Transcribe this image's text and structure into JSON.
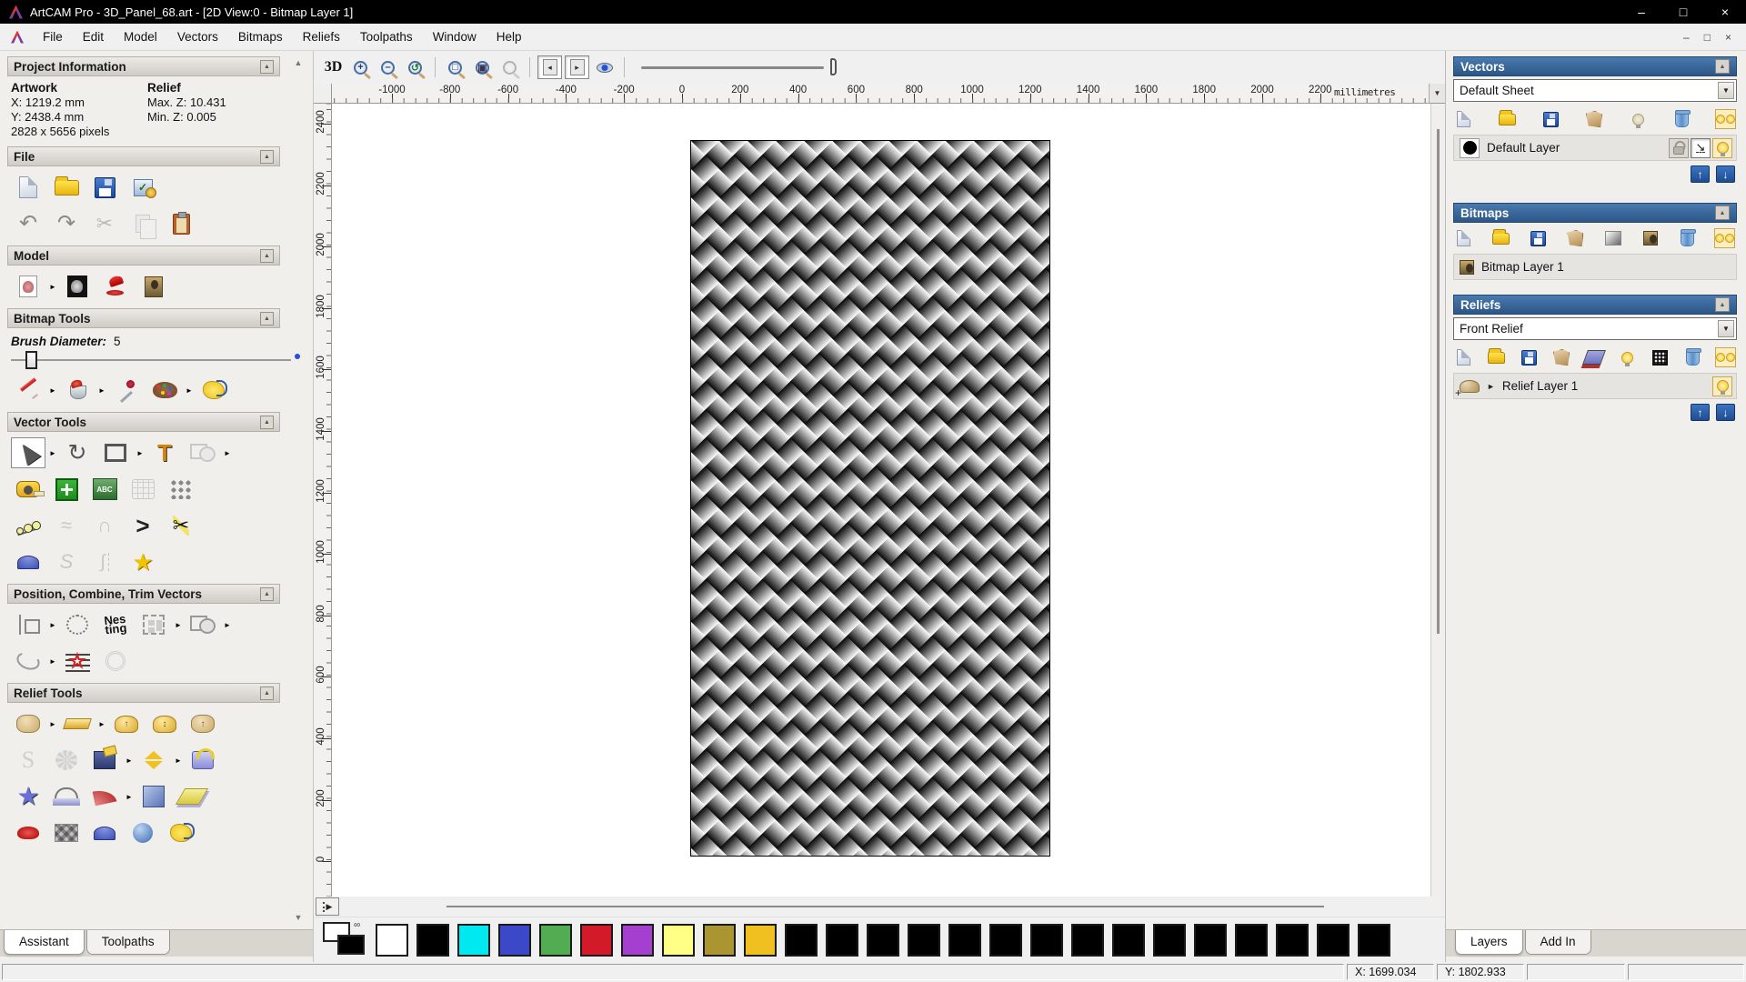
{
  "window": {
    "title": "ArtCAM Pro - 3D_Panel_68.art - [2D View:0 - Bitmap Layer 1]"
  },
  "titlebar": {
    "minimize": "–",
    "maximize": "□",
    "close": "×"
  },
  "menu": {
    "items": [
      "File",
      "Edit",
      "Model",
      "Vectors",
      "Bitmaps",
      "Reliefs",
      "Toolpaths",
      "Window",
      "Help"
    ]
  },
  "mdi": {
    "minimize": "–",
    "restore": "□",
    "close": "×"
  },
  "icons": {
    "collapse": "▲",
    "dropdown": "▼",
    "flyout": "►",
    "undo": "↶",
    "redo": "↷",
    "cut": "✂",
    "scroll_up": "▲",
    "scroll_down": "▼",
    "splitter": "▶",
    "move_up": "↑",
    "move_down": "↓",
    "expand": "►",
    "snap": "↘",
    "text_tool": "T",
    "abc": "ABC",
    "s_curve": "S",
    "vee": ">",
    "star": "★",
    "check": "✓",
    "link": "∞",
    "transform": "↻",
    "zoom_in": "+",
    "zoom_out": "–",
    "page_in": "◂",
    "page_out": "▸"
  },
  "assistant": {
    "sections": {
      "project_information": "Project Information",
      "file": "File",
      "model": "Model",
      "bitmap_tools": "Bitmap Tools",
      "vector_tools": "Vector Tools",
      "position_combine_trim": "Position, Combine, Trim Vectors",
      "relief_tools": "Relief Tools"
    },
    "project_info": {
      "artwork_label": "Artwork",
      "relief_label": "Relief",
      "x": "X: 1219.2 mm",
      "y": "Y: 2438.4 mm",
      "pixels": "2828 x 5656 pixels",
      "max_z": "Max. Z: 10.431",
      "min_z": "Min. Z: 0.005"
    },
    "brush": {
      "label": "Brush Diameter:",
      "value": "5"
    },
    "nesting": {
      "top": "Nes",
      "bottom": "ting"
    },
    "tabs": [
      "Assistant",
      "Toolpaths"
    ]
  },
  "canvas": {
    "toolbar": {
      "view_3d": "3D"
    },
    "rulers": {
      "horizontal": {
        "ticks": [
          "-1000",
          "-800",
          "-600",
          "-400",
          "-200",
          "0",
          "200",
          "400",
          "600",
          "800",
          "1000",
          "1200",
          "1400",
          "1600",
          "1800",
          "2000",
          "2200"
        ],
        "units": "millimetres"
      },
      "vertical": {
        "ticks": [
          "2400",
          "2200",
          "2000",
          "1800",
          "1600",
          "1400",
          "1200",
          "1000",
          "800",
          "600",
          "400",
          "200",
          "0"
        ]
      }
    }
  },
  "layers_panel": {
    "vectors": {
      "title": "Vectors",
      "sheet_selector": "Default Sheet",
      "layer": "Default Layer"
    },
    "bitmaps": {
      "title": "Bitmaps",
      "layer": "Bitmap Layer 1"
    },
    "reliefs": {
      "title": "Reliefs",
      "relief_selector": "Front Relief",
      "layer": "Relief Layer 1"
    },
    "tabs": [
      "Layers",
      "Add In"
    ]
  },
  "palette": {
    "primary": "#ffffff",
    "secondary": "#000000",
    "swatches": [
      "#ffffff",
      "#000000",
      "#00e8f0",
      "#3b48c8",
      "#52ad52",
      "#d31a28",
      "#a43fd0",
      "#ffff85",
      "#ab9530",
      "#f0c020",
      "#000000",
      "#000000",
      "#000000",
      "#000000",
      "#000000",
      "#000000",
      "#000000",
      "#000000",
      "#000000",
      "#000000",
      "#000000",
      "#000000",
      "#000000",
      "#000000",
      "#000000"
    ]
  },
  "status": {
    "x": "X: 1699.034",
    "y": "Y: 1802.933"
  },
  "accent_colors": {
    "panel_header_blue": "#2c5687",
    "titlebar": "#000000"
  }
}
